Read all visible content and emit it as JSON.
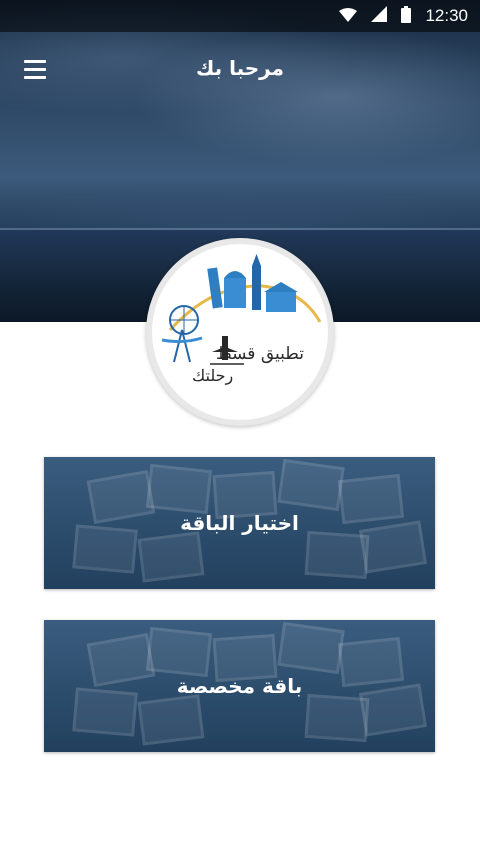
{
  "status_bar": {
    "time": "12:30",
    "icons": [
      "wifi-icon",
      "signal-icon",
      "battery-icon"
    ]
  },
  "app_bar": {
    "title": "مرحبا بك",
    "menu_icon": "hamburger-menu-icon"
  },
  "logo": {
    "line1": "تطبيق قسط",
    "line2": "رحلتك"
  },
  "cards": [
    {
      "label": "اختيار الباقة"
    },
    {
      "label": "باقة مخصصة"
    }
  ],
  "colors": {
    "card": "#2e4e6e",
    "header": "#2f4a68",
    "logo_accent": "#e8b84a",
    "logo_blue": "#2e7fc2"
  }
}
